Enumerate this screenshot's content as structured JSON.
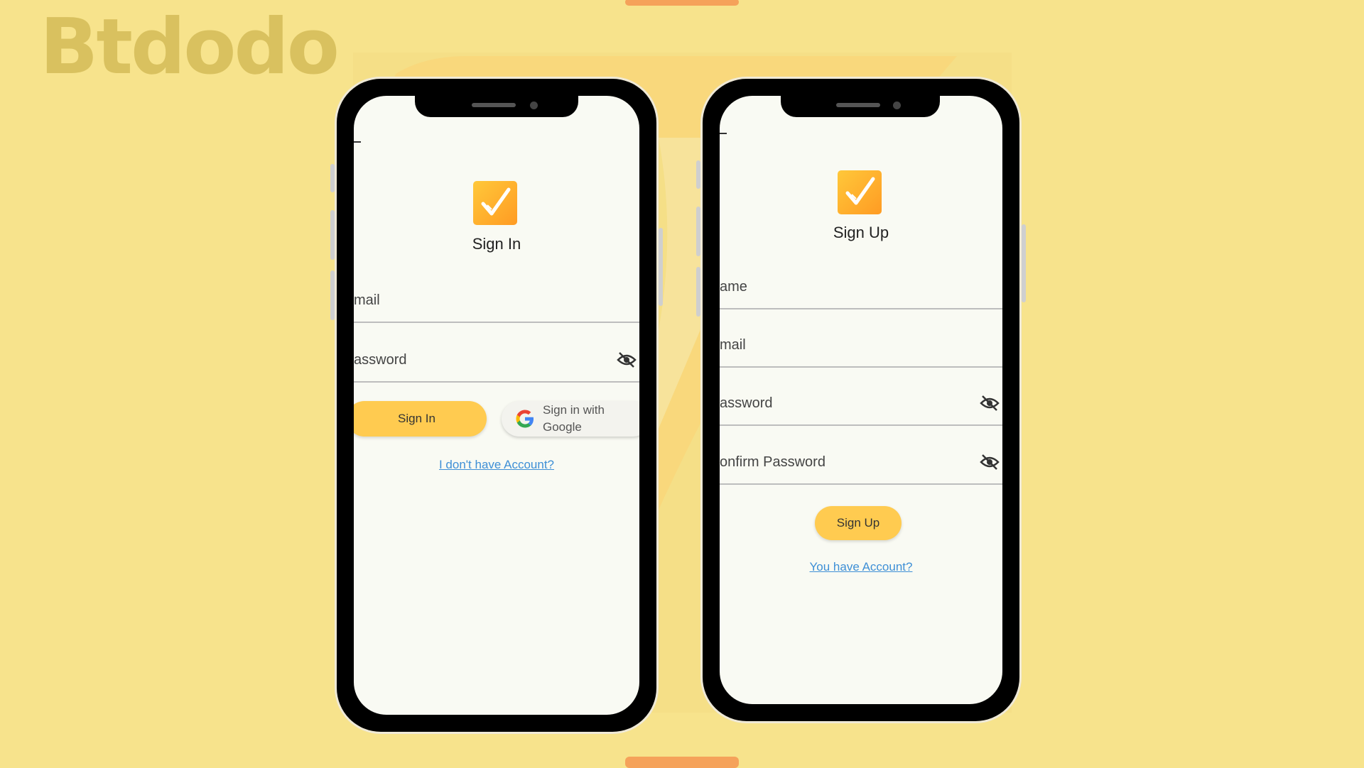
{
  "brand": {
    "name": "Btdodo",
    "color": "#d9c15f"
  },
  "colors": {
    "background": "#f7e38c",
    "button": "#ffcb50",
    "link": "#3e8fd6",
    "accent_tab": "#f5a25a"
  },
  "signin": {
    "title": "Sign In",
    "email_label": "mail",
    "password_label": "assword",
    "signin_button": "Sign In",
    "google_button_line1": "Sign in with",
    "google_button_line2": "Google",
    "link": "I don't have Account?"
  },
  "signup": {
    "title": "Sign Up",
    "name_label": "ame",
    "email_label": "mail",
    "password_label": "assword",
    "confirm_label": "onfirm Password",
    "signup_button": "Sign Up",
    "link": "You have Account?"
  },
  "icons": {
    "logo": "checkmark-logo-icon",
    "visibility": "eye-off-icon",
    "google": "google-g-icon"
  }
}
